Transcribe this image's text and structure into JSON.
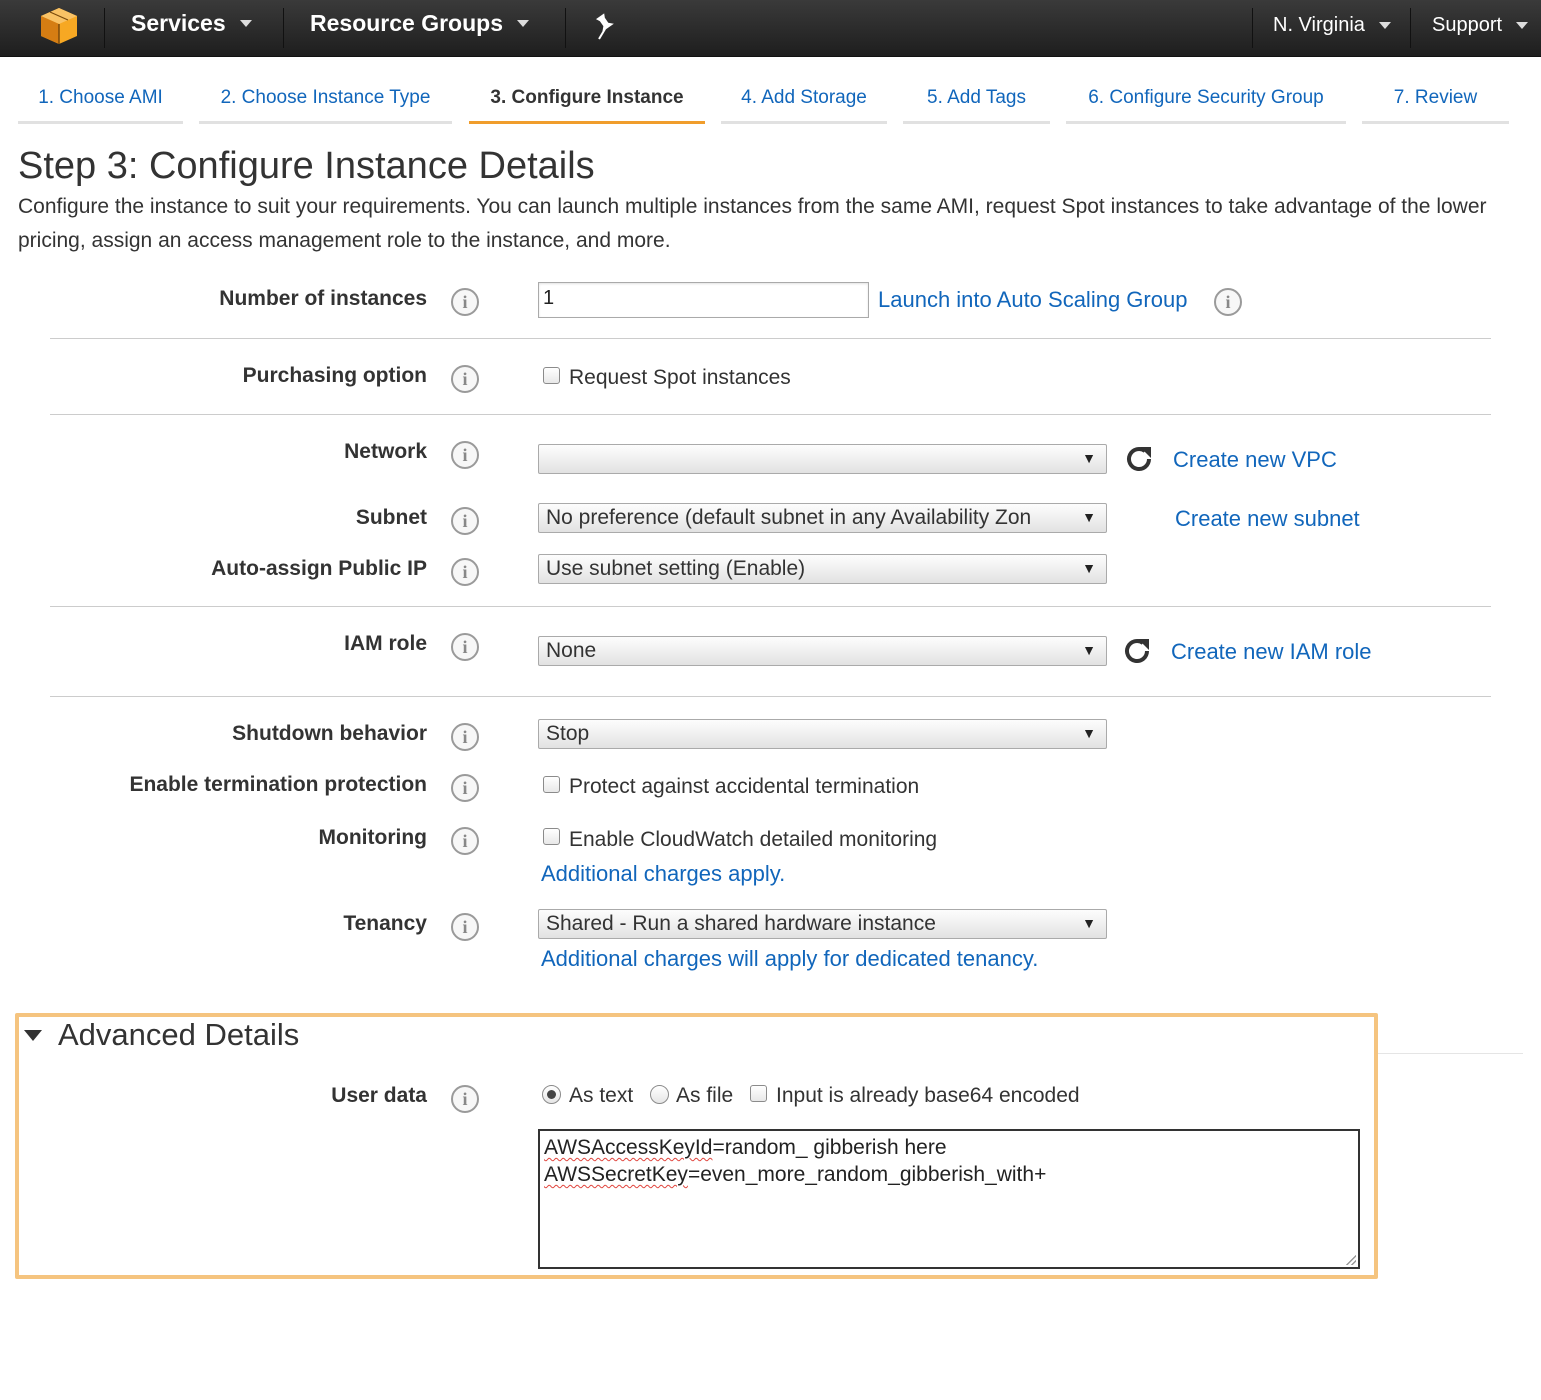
{
  "topbar": {
    "services_label": "Services",
    "resource_groups_label": "Resource Groups",
    "region_label": "N. Virginia",
    "support_label": "Support"
  },
  "tabs": [
    {
      "label": "1. Choose AMI",
      "active": false
    },
    {
      "label": "2. Choose Instance Type",
      "active": false
    },
    {
      "label": "3. Configure Instance",
      "active": true
    },
    {
      "label": "4. Add Storage",
      "active": false
    },
    {
      "label": "5. Add Tags",
      "active": false
    },
    {
      "label": "6. Configure Security Group",
      "active": false
    },
    {
      "label": "7. Review",
      "active": false
    }
  ],
  "page": {
    "title": "Step 3: Configure Instance Details",
    "description": "Configure the instance to suit your requirements. You can launch multiple instances from the same AMI, request Spot instances to take advantage of the lower pricing, assign an access management role to the instance, and more."
  },
  "form": {
    "instances": {
      "label": "Number of instances",
      "value": "1",
      "link": "Launch into Auto Scaling Group"
    },
    "purchasing": {
      "label": "Purchasing option",
      "checkbox_label": "Request Spot instances",
      "checked": false
    },
    "network": {
      "label": "Network",
      "value": "",
      "link": "Create new VPC"
    },
    "subnet": {
      "label": "Subnet",
      "value": "No preference (default subnet in any Availability Zon",
      "link": "Create new subnet"
    },
    "public_ip": {
      "label": "Auto-assign Public IP",
      "value": "Use subnet setting (Enable)"
    },
    "iam": {
      "label": "IAM role",
      "value": "None",
      "link": "Create new IAM role"
    },
    "shutdown": {
      "label": "Shutdown behavior",
      "value": "Stop"
    },
    "termination": {
      "label": "Enable termination protection",
      "checkbox_label": "Protect against accidental termination",
      "checked": false
    },
    "monitoring": {
      "label": "Monitoring",
      "checkbox_label": "Enable CloudWatch detailed monitoring",
      "checked": false,
      "note": "Additional charges apply."
    },
    "tenancy": {
      "label": "Tenancy",
      "value": "Shared - Run a shared hardware instance",
      "note": "Additional charges will apply for dedicated tenancy."
    }
  },
  "advanced": {
    "title": "Advanced Details",
    "user_data": {
      "label": "User data",
      "as_text": "As text",
      "as_file": "As file",
      "base64": "Input is already base64 encoded",
      "selected": "As text",
      "line1_key": "AWSAccessKeyId",
      "line1_rest": "=random_ gibberish here",
      "line2_key": "AWSSecretKey",
      "line2_rest": "=even_more_random_gibberish_with+"
    }
  },
  "colors": {
    "accent": "#f09d2c",
    "link": "#1166bb",
    "highlight_border": "#f5c47f",
    "topbar": "#232f3e"
  },
  "icons": [
    "aws-cube-icon",
    "pin-icon",
    "info-icon",
    "refresh-icon",
    "caret-down-icon",
    "triangle-down-icon"
  ]
}
